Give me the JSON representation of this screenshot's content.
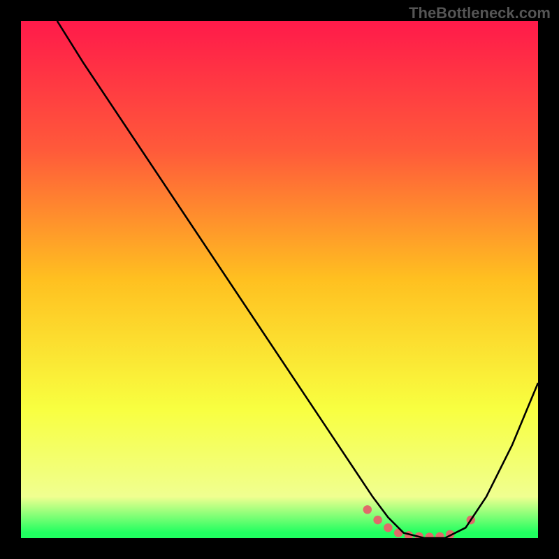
{
  "watermark": "TheBottleneck.com",
  "chart_data": {
    "type": "line",
    "title": "",
    "xlabel": "",
    "ylabel": "",
    "xlim": [
      0,
      100
    ],
    "ylim": [
      0,
      100
    ],
    "gradient_stops": [
      {
        "offset": 0,
        "color": "#ff1a4a"
      },
      {
        "offset": 25,
        "color": "#ff5a3a"
      },
      {
        "offset": 50,
        "color": "#ffc020"
      },
      {
        "offset": 75,
        "color": "#f8ff40"
      },
      {
        "offset": 92,
        "color": "#f0ff90"
      },
      {
        "offset": 99,
        "color": "#20ff60"
      }
    ],
    "series": [
      {
        "name": "bottleneck-curve",
        "color": "#000000",
        "x": [
          7,
          12,
          20,
          30,
          40,
          50,
          58,
          64,
          68,
          71,
          74,
          78,
          82,
          86,
          90,
          95,
          100
        ],
        "y": [
          100,
          92,
          80,
          65,
          50,
          35,
          23,
          14,
          8,
          4,
          1,
          0,
          0,
          2,
          8,
          18,
          30
        ]
      }
    ],
    "scatter": {
      "name": "highlight-points",
      "color": "#e06a6a",
      "radius": 6,
      "points": [
        {
          "x": 67,
          "y": 5.5
        },
        {
          "x": 69,
          "y": 3.5
        },
        {
          "x": 71,
          "y": 2
        },
        {
          "x": 73,
          "y": 1
        },
        {
          "x": 75,
          "y": 0.5
        },
        {
          "x": 77,
          "y": 0.3
        },
        {
          "x": 79,
          "y": 0.2
        },
        {
          "x": 81,
          "y": 0.3
        },
        {
          "x": 83,
          "y": 0.7
        },
        {
          "x": 87,
          "y": 3.5
        }
      ]
    }
  }
}
